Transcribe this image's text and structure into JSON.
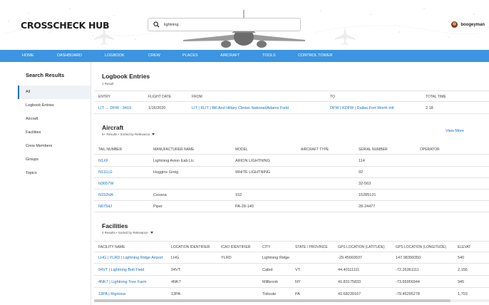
{
  "header": {
    "logo": "CROSSCHECK HUB",
    "search": {
      "value": "lightning",
      "placeholder": ""
    },
    "user": {
      "name": "boogeyman"
    }
  },
  "nav": {
    "items": [
      {
        "label": "HOME"
      },
      {
        "label": "DASHBOARD"
      },
      {
        "label": "LOGBOOK"
      },
      {
        "label": "CREW"
      },
      {
        "label": "PLACES"
      },
      {
        "label": "AIRCRAFT"
      },
      {
        "label": "TOOLS"
      },
      {
        "label": "CONTROL TOWER"
      }
    ]
  },
  "sidebar": {
    "title": "Search Results",
    "items": [
      {
        "label": "All"
      },
      {
        "label": "Logbook Entries"
      },
      {
        "label": "Aircraft"
      },
      {
        "label": "Facilities"
      },
      {
        "label": "Crew Members"
      },
      {
        "label": "Groups"
      },
      {
        "label": "Topics"
      }
    ]
  },
  "logbook": {
    "title": "Logbook Entries",
    "subtitle": "1 Result",
    "columns": [
      "ENTRY",
      "FLIGHT DATE",
      "FROM",
      "TO",
      "TOTAL TIME"
    ],
    "rows": [
      {
        "entry": "LIT → DFW - 3419",
        "date": "1/16/2020",
        "from": "LIT | KLIT | Bill And Hillary Clinton National/Adams Field",
        "to": "DFW | KDFW | Dallas-Fort Worth Intl",
        "time": "2.18"
      }
    ]
  },
  "aircraft": {
    "title": "Aircraft",
    "subtitle": "5+ Results • Sorted by Relevance",
    "view_more": "View More",
    "columns": [
      "TAIL NUMBER",
      "MANUFACTURER NAME",
      "MODEL",
      "AIRCRAFT TYPE",
      "SERIAL NUMBER",
      "OPERATOR"
    ],
    "rows": [
      {
        "tail": "N1XF",
        "mfr": "Lightning Avion Eab Llc",
        "model": "ARION LIGHTNING",
        "type": "",
        "serial": "114",
        "operator": ""
      },
      {
        "tail": "N111LG",
        "mfr": "Huggins Greig",
        "model": "WHITE LIGHTNING",
        "type": "",
        "serial": "92",
        "operator": ""
      },
      {
        "tail": "N3657W",
        "mfr": "",
        "model": "",
        "type": "",
        "serial": "32-563",
        "operator": ""
      },
      {
        "tail": "N152HA",
        "mfr": "Cessna",
        "model": "152",
        "type": "",
        "serial": "15285121",
        "operator": ""
      },
      {
        "tail": "N6754J",
        "mfr": "Piper",
        "model": "PA-28-140",
        "type": "",
        "serial": "28-24477",
        "operator": ""
      }
    ]
  },
  "facilities": {
    "title": "Facilities",
    "subtitle": "4 Results • Sorted by Relevance",
    "columns": [
      "FACILITY NAME",
      "LOCATION IDENTIFIER",
      "ICAO IDENTIFIER",
      "CITY",
      "STATE / PROVINCE",
      "GPS LOCATION (LATITUDE)",
      "GPS LOCATION (LONGITUDE)",
      "ELEVAT"
    ],
    "rows": [
      {
        "name": "LHG | YLRD | Lightning Ridge Airport",
        "loc": "LHG",
        "icao": "YLRD",
        "city": "Lightning Ridge",
        "state": "",
        "lat": "-29.45669937",
        "lon": "147.98399350",
        "elev": "540"
      },
      {
        "name": "04VT | Lightning Bolt Field",
        "loc": "04VT",
        "icao": "",
        "city": "Cabot",
        "state": "VT",
        "lat": "44.40111111",
        "lon": "-72.26361111",
        "elev": "2,156"
      },
      {
        "name": "4NK7 | Lightning Tree Farm",
        "loc": "4NK7",
        "icao": "",
        "city": "Millbrook",
        "state": "NY",
        "lat": "41.83175833",
        "lon": "-73.65956944",
        "elev": "945"
      },
      {
        "name": "13PA | Rigrtona",
        "loc": "13PA",
        "icao": "",
        "city": "Tidioute",
        "state": "PA",
        "lat": "41.68239167",
        "lon": "-79.45295278",
        "elev": "1,703"
      }
    ]
  }
}
